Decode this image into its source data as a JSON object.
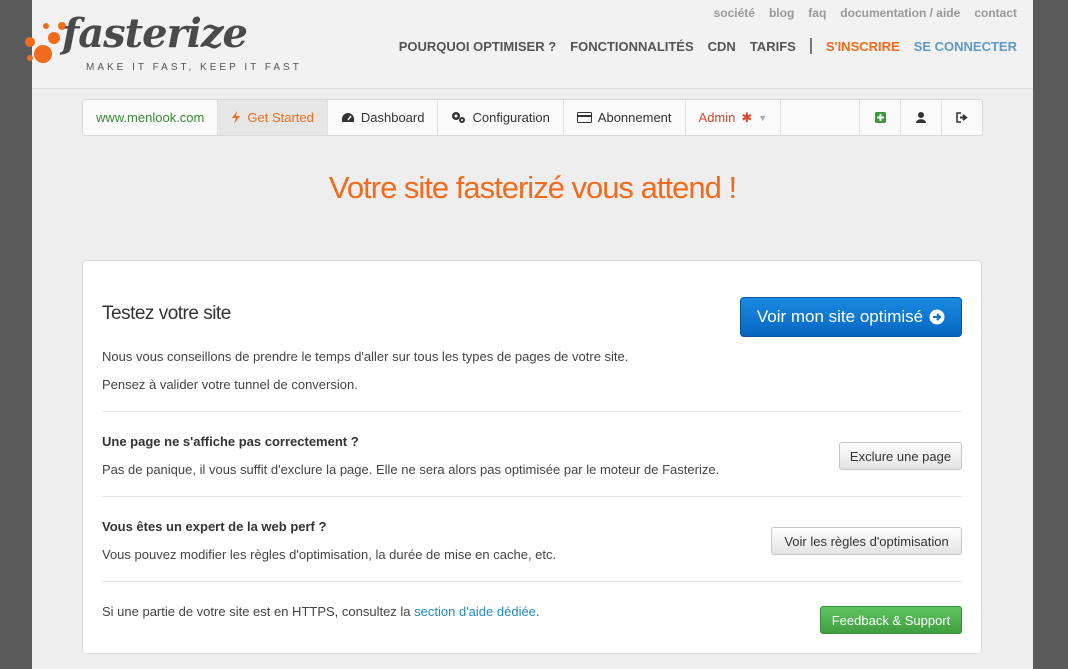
{
  "logo": {
    "name": "fasterize",
    "tagline": "MAKE IT FAST, KEEP IT FAST"
  },
  "top_links": [
    "société",
    "blog",
    "faq",
    "documentation / aide",
    "contact"
  ],
  "main_nav": {
    "items": [
      "POURQUOI OPTIMISER ?",
      "FONCTIONNALITÉS",
      "CDN",
      "TARIFS"
    ],
    "signup": "S'INSCRIRE",
    "login": "SE CONNECTER"
  },
  "app_nav": {
    "site": "www.menlook.com",
    "get_started": "Get Started",
    "dashboard": "Dashboard",
    "configuration": "Configuration",
    "abonnement": "Abonnement",
    "admin": "Admin"
  },
  "page_title": "Votre site fasterizé vous attend !",
  "test_section": {
    "heading": "Testez votre site",
    "button": "Voir mon site optimisé",
    "line1": "Nous vous conseillons de prendre le temps d'aller sur tous les types de pages de votre site.",
    "line2": "Pensez à valider votre tunnel de conversion."
  },
  "exclude_section": {
    "heading": "Une page ne s'affiche pas correctement ?",
    "text": "Pas de panique, il vous suffit d'exclure la page. Elle ne sera alors pas optimisée par le moteur de Fasterize.",
    "button": "Exclure une page"
  },
  "expert_section": {
    "heading": "Vous êtes un expert de la web perf ?",
    "text": "Vous pouvez modifier les règles d'optimisation, la durée de mise en cache, etc.",
    "button": "Voir les règles d'optimisation"
  },
  "https_section": {
    "text_before": "Si une partie de votre site est en HTTPS, consultez la",
    "link": "section d'aide dédiée",
    "text_after": ".",
    "button": "Feedback & Support"
  },
  "colors": {
    "brand_orange": "#f26b1d",
    "primary_blue": "#0a72d1",
    "success_green": "#4cae4c"
  }
}
